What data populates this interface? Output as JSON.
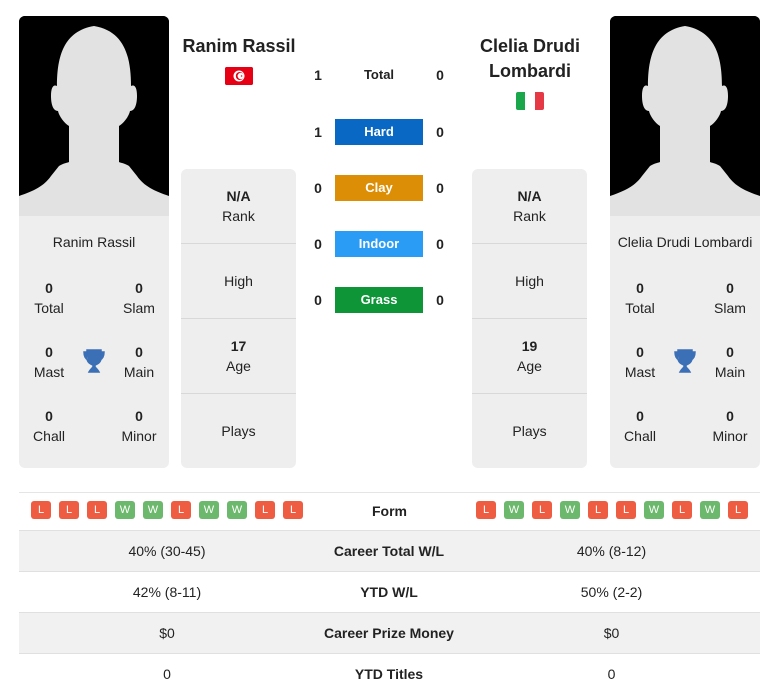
{
  "players": {
    "left": {
      "name": "Ranim Rassil",
      "photo_caption": "Ranim Rassil",
      "flag": "tunisia-flag",
      "titles": {
        "total": {
          "value": "0",
          "label": "Total"
        },
        "slam": {
          "value": "0",
          "label": "Slam"
        },
        "mast": {
          "value": "0",
          "label": "Mast"
        },
        "main": {
          "value": "0",
          "label": "Main"
        },
        "chall": {
          "value": "0",
          "label": "Chall"
        },
        "minor": {
          "value": "0",
          "label": "Minor"
        }
      },
      "info": {
        "rank_value": "N/A",
        "rank_label": "Rank",
        "high_label": "High",
        "age_value": "17",
        "age_label": "Age",
        "plays_label": "Plays"
      },
      "form": [
        "L",
        "L",
        "L",
        "W",
        "W",
        "L",
        "W",
        "W",
        "L",
        "L"
      ]
    },
    "right": {
      "name": "Clelia Drudi Lombardi",
      "photo_caption": "Clelia Drudi Lombardi",
      "flag": "italy-flag",
      "titles": {
        "total": {
          "value": "0",
          "label": "Total"
        },
        "slam": {
          "value": "0",
          "label": "Slam"
        },
        "mast": {
          "value": "0",
          "label": "Mast"
        },
        "main": {
          "value": "0",
          "label": "Main"
        },
        "chall": {
          "value": "0",
          "label": "Chall"
        },
        "minor": {
          "value": "0",
          "label": "Minor"
        }
      },
      "info": {
        "rank_value": "N/A",
        "rank_label": "Rank",
        "high_label": "High",
        "age_value": "19",
        "age_label": "Age",
        "plays_label": "Plays"
      },
      "form": [
        "L",
        "W",
        "L",
        "W",
        "L",
        "L",
        "W",
        "L",
        "W",
        "L"
      ]
    }
  },
  "h2h": [
    {
      "label": "Total",
      "left": "1",
      "right": "0",
      "color": ""
    },
    {
      "label": "Hard",
      "left": "1",
      "right": "0",
      "color": "#0968c3"
    },
    {
      "label": "Clay",
      "left": "0",
      "right": "0",
      "color": "#dc8e07"
    },
    {
      "label": "Indoor",
      "left": "0",
      "right": "0",
      "color": "#2a9cf5"
    },
    {
      "label": "Grass",
      "left": "0",
      "right": "0",
      "color": "#0d9538"
    }
  ],
  "form_label": "Form",
  "stats": [
    {
      "left": "40% (30-45)",
      "label": "Career Total W/L",
      "right": "40% (8-12)"
    },
    {
      "left": "42% (8-11)",
      "label": "YTD W/L",
      "right": "50% (2-2)"
    },
    {
      "left": "$0",
      "label": "Career Prize Money",
      "right": "$0"
    },
    {
      "left": "0",
      "label": "YTD Titles",
      "right": "0"
    }
  ],
  "colors": {
    "loss": "#ee5c42",
    "win": "#6cb86c",
    "trophy": "#3b6fb6",
    "italy_green": "#1aa64a",
    "italy_red": "#e63946",
    "tunisia_red": "#e70013"
  }
}
